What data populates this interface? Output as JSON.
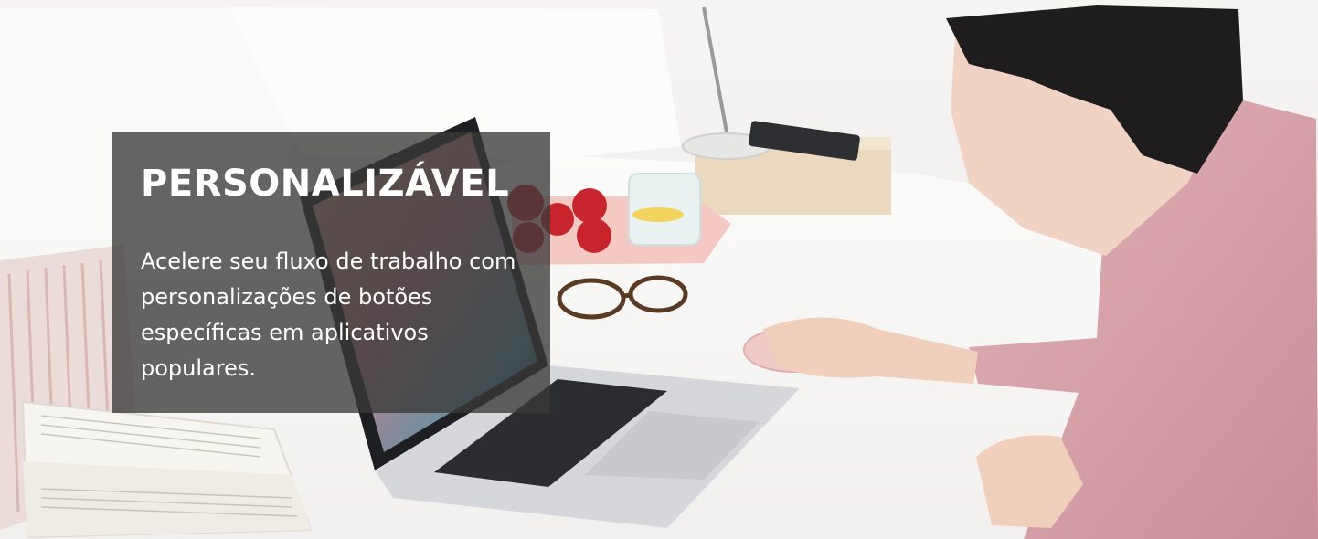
{
  "banner": {
    "headline": "PERSONALIZÁVEL",
    "body": "Acelere seu fluxo de trabalho com personalizações de botões específicas em aplicativos populares."
  },
  "colors": {
    "overlay": "#3a3a3a",
    "text": "#ffffff",
    "hoodie": "#d9a5ad",
    "mouse": "#f0c9c9",
    "laptop": "#c9cbcf",
    "bedding": "#f8f8f7"
  }
}
